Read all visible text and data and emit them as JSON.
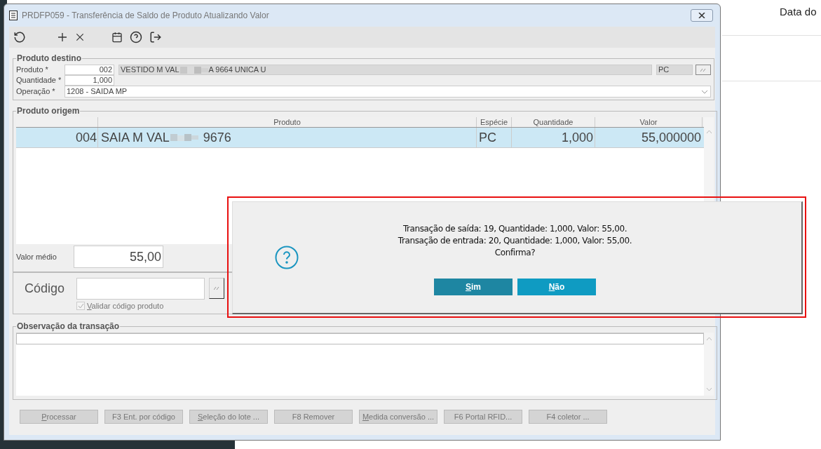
{
  "background": {
    "header_text": "Data do"
  },
  "window": {
    "title": "PRDFP059 - Transferência de Saldo de Produto Atualizando Valor"
  },
  "produto_destino": {
    "legend": "Produto destino",
    "fields": [
      {
        "label": "Produto *",
        "code": "002",
        "description_start": "VESTIDO M VAL",
        "description_end": "A 9664 UNICA U",
        "unit": "PC"
      },
      {
        "label": "Quantidade *",
        "value": "1,000"
      },
      {
        "label": "Operação *",
        "value": "1208 - SAIDA MP"
      }
    ]
  },
  "produto_origem": {
    "legend": "Produto origem",
    "columns": [
      "",
      "Produto",
      "Espécie",
      "Quantidade",
      "Valor"
    ],
    "rows": [
      {
        "selected": true,
        "code": "004",
        "produto_start": "SAIA M VAL",
        "produto_end": "9676",
        "especie": "PC",
        "quantidade": "1,000",
        "valor": "55,000000"
      }
    ],
    "valor_medio": {
      "label": "Valor médio",
      "value": "55,00"
    }
  },
  "codigo": {
    "label": "Código",
    "checkbox": {
      "label": "Validar código produto",
      "checked": true,
      "disabled": true
    }
  },
  "observacao": {
    "legend": "Observação da transação"
  },
  "buttons": [
    {
      "label": "Processar",
      "disabled": true,
      "mnemonic": true
    },
    {
      "label": "F3 Ent. por código",
      "disabled": true,
      "mnemonic": false
    },
    {
      "label": "Seleção do lote ...",
      "disabled": true,
      "mnemonic": true
    },
    {
      "label": "F8 Remover",
      "disabled": true,
      "mnemonic": false
    },
    {
      "label": "Medida conversão ...",
      "disabled": true,
      "mnemonic": true
    },
    {
      "label": "F6 Portal RFID...",
      "disabled": true,
      "mnemonic": false
    },
    {
      "label": "F4 coletor ...",
      "disabled": true,
      "mnemonic": false
    }
  ],
  "dialog": {
    "lines": [
      "Transação de saída: 19, Quantidade: 1,000, Valor: 55,00.",
      "Transação de entrada: 20, Quantidade: 1,000, Valor: 55,00.",
      "Confirma?"
    ],
    "buttons": [
      {
        "label": "Sim",
        "selected": true
      },
      {
        "label": "Não",
        "selected": false
      }
    ]
  }
}
